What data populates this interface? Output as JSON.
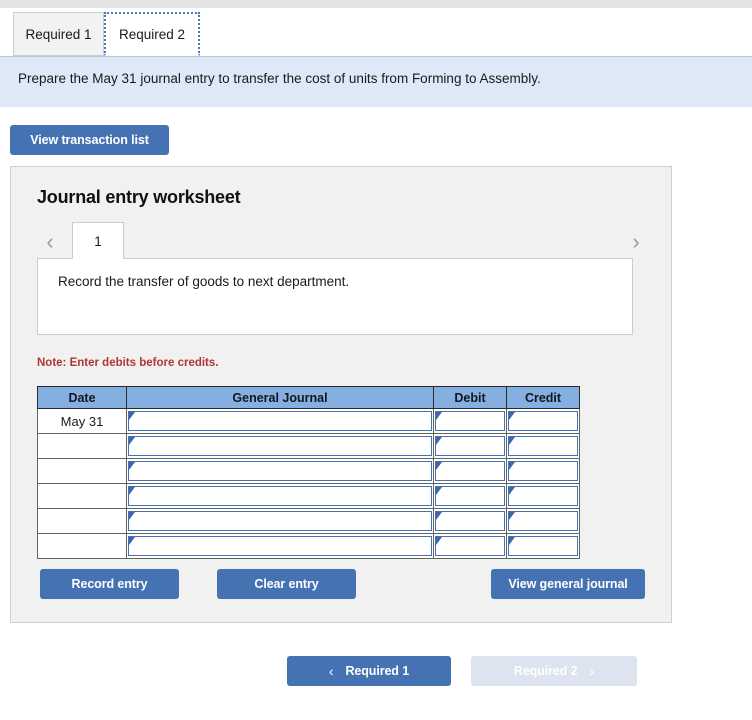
{
  "top_tabs": [
    {
      "label": "Required 1",
      "active": false
    },
    {
      "label": "Required 2",
      "active": true
    }
  ],
  "banner": {
    "instruction": "Prepare the May 31 journal entry to transfer the cost of units from Forming to Assembly."
  },
  "toolbar": {
    "view_transaction_list": "View transaction list"
  },
  "worksheet": {
    "title": "Journal entry worksheet",
    "prev_icon": "chevron-left-icon",
    "next_icon": "chevron-right-icon",
    "prev_glyph": "‹",
    "next_glyph": "›",
    "sheet_tabs": [
      {
        "label": "1",
        "active": true
      }
    ],
    "prompt": "Record the transfer of goods to next department.",
    "note": "Note: Enter debits before credits.",
    "table": {
      "headers": [
        "Date",
        "General Journal",
        "Debit",
        "Credit"
      ],
      "rows": [
        {
          "date": "May 31",
          "general_journal": "",
          "debit": "",
          "credit": ""
        },
        {
          "date": "",
          "general_journal": "",
          "debit": "",
          "credit": ""
        },
        {
          "date": "",
          "general_journal": "",
          "debit": "",
          "credit": ""
        },
        {
          "date": "",
          "general_journal": "",
          "debit": "",
          "credit": ""
        },
        {
          "date": "",
          "general_journal": "",
          "debit": "",
          "credit": ""
        },
        {
          "date": "",
          "general_journal": "",
          "debit": "",
          "credit": ""
        }
      ]
    },
    "buttons": {
      "record_entry": "Record entry",
      "clear_entry": "Clear entry",
      "view_general_journal": "View general journal"
    }
  },
  "bottom_nav": {
    "prev_label": "Required 1",
    "prev_glyph": "‹",
    "next_label": "Required 2",
    "next_glyph": "›"
  },
  "colors": {
    "primary_blue": "#4572b3",
    "table_header_blue": "#85aee1",
    "banner_blue": "#dde9f7",
    "panel_gray": "#f1f1f1",
    "note_red": "#b03535",
    "disabled_blue": "#dde4ef"
  }
}
